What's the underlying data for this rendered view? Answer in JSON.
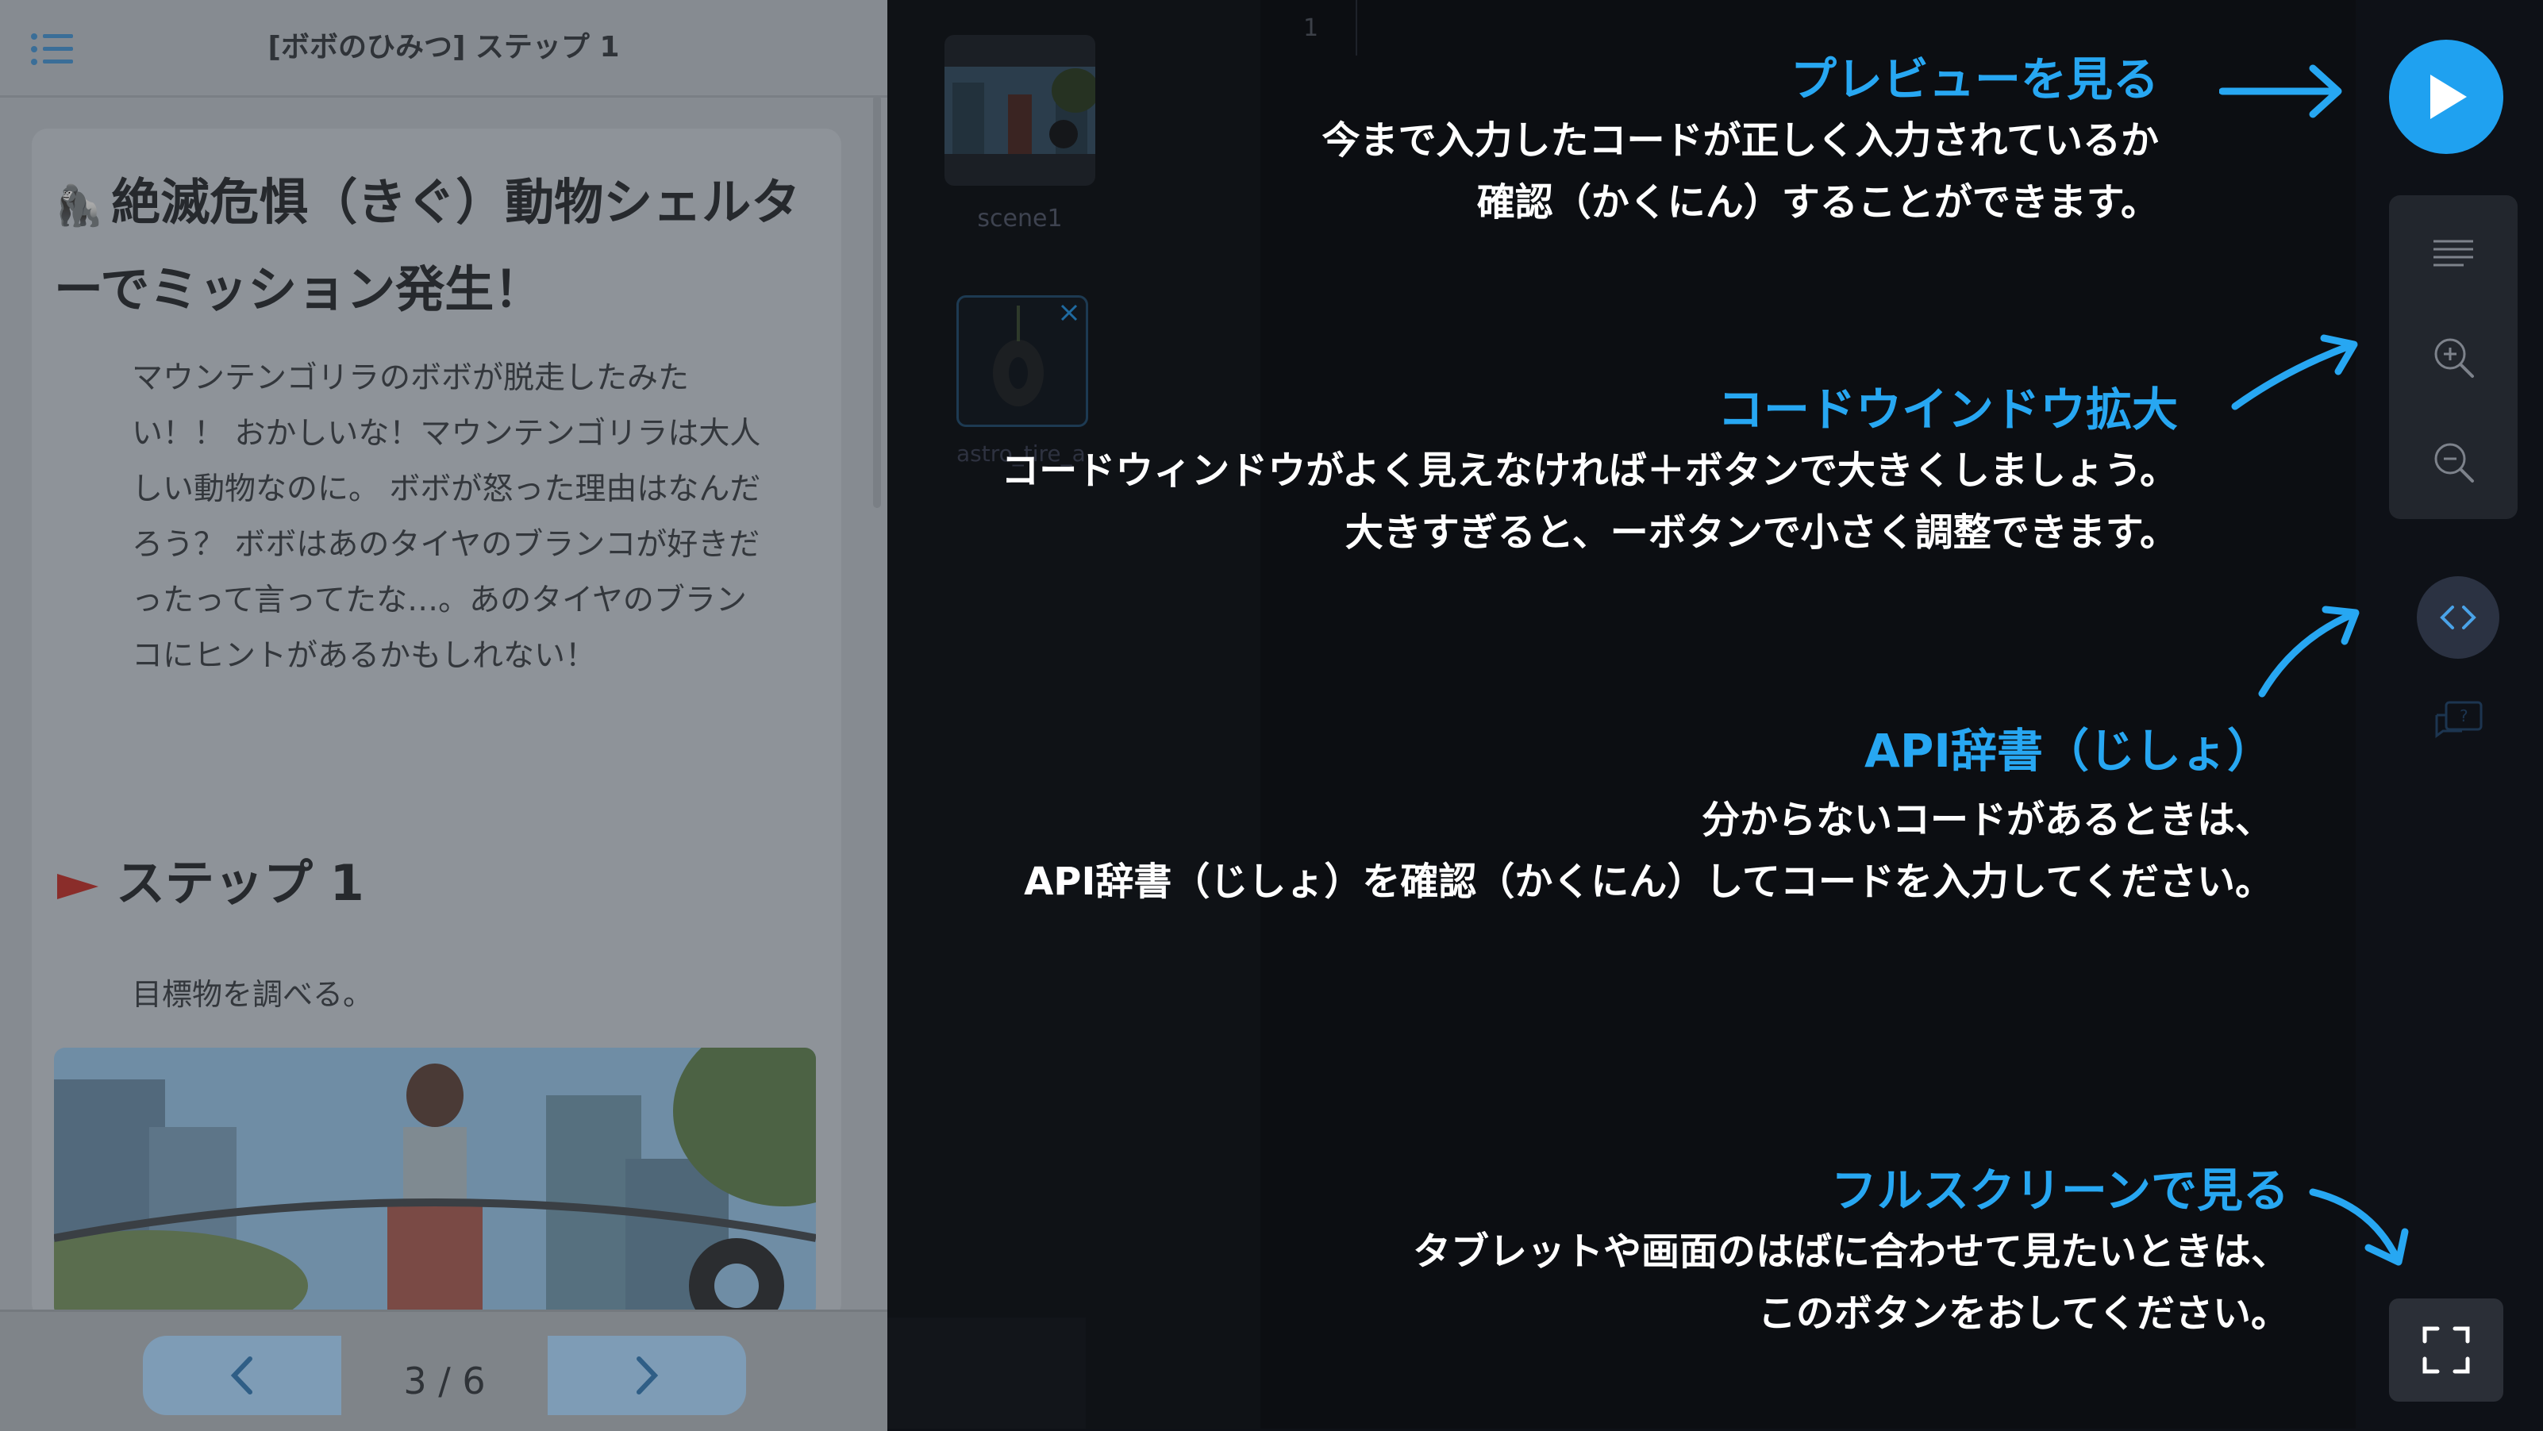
{
  "lesson": {
    "title": "[ボボのひみつ] ステップ 1",
    "heading": "絶滅危惧（きぐ）動物シェルターでミッション発生！",
    "heading_emoji": "🦍",
    "story": "マウンテンゴリラのボボが脱走したみたい！！ おかしいな！マウンテンゴリラは大人しい動物なのに。 ボボが怒った理由はなんだろう？ ボボはあのタイヤのブランコが好きだったって言ってたな…。あのタイヤのブランコにヒントがあるかもしれない！",
    "step_label": "ステップ 1",
    "step_goal": "目標物を調べる。"
  },
  "pager": {
    "count": "3 / 6"
  },
  "editor": {
    "line_number": "1",
    "assets": [
      {
        "label": "scene1"
      },
      {
        "label": "astro_tire_a"
      }
    ]
  },
  "tips": {
    "preview": {
      "title": "プレビューを見る",
      "line1": "今まで入力したコードが正しく入力されているか",
      "line2": "確認（かくにん）することができます。"
    },
    "zoom": {
      "title": "コードウインドウ拡大",
      "line1": "コードウィンドウがよく見えなければ＋ボタンで大きくしましょう。",
      "line2": "大きすぎると、ーボタンで小さく調整できます。"
    },
    "api": {
      "title": "API辞書（じしょ）",
      "line1": "分からないコードがあるときは、",
      "line2": "API辞書（じしょ）を確認（かくにん）してコードを入力してください。"
    },
    "fullscreen": {
      "title": "フルスクリーンで見る",
      "line1": "タブレットや画面のはばに合わせて見たいときは、",
      "line2": "このボタンをおしてください。"
    }
  },
  "colors": {
    "accent": "#27a7f2",
    "run_button": "#1fa1f0",
    "overlay_panel": "#868b91",
    "background": "#0e1117"
  },
  "icons": [
    "menu-icon",
    "play-icon",
    "format-lines-icon",
    "zoom-in-icon",
    "zoom-out-icon",
    "code-brackets-icon",
    "help-chat-icon",
    "fullscreen-icon",
    "chevron-left-icon",
    "chevron-right-icon",
    "flag-icon"
  ]
}
